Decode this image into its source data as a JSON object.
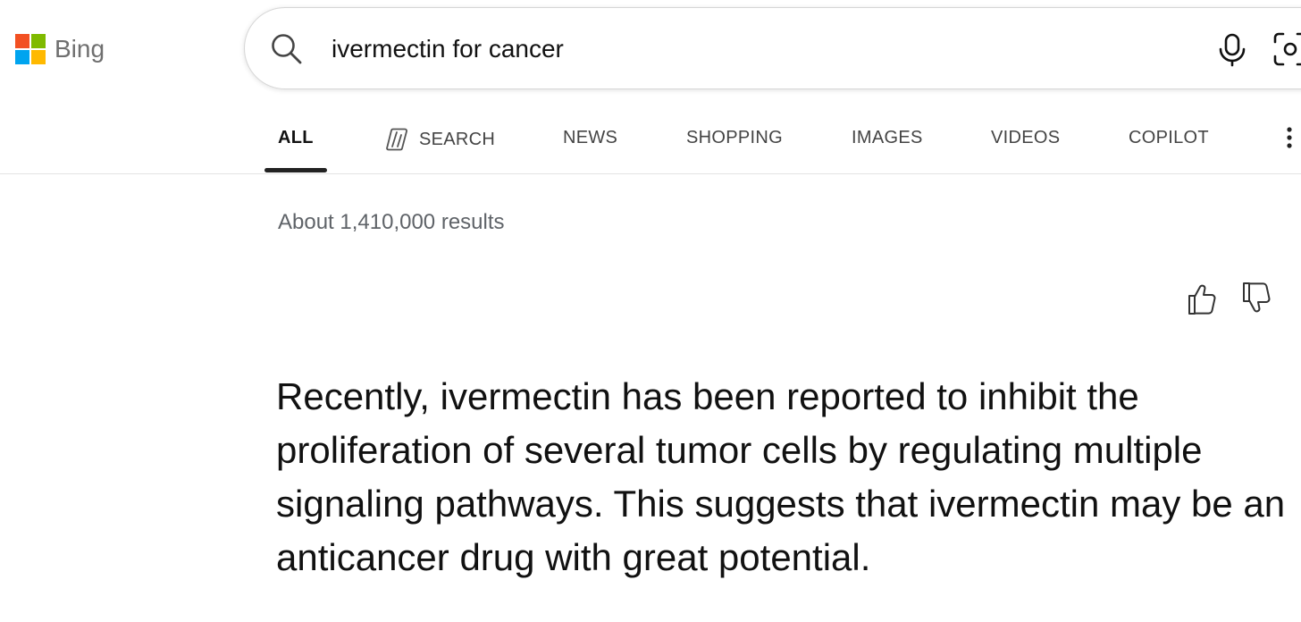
{
  "logo": {
    "text": "Bing",
    "colors": [
      "#f25022",
      "#7fba00",
      "#00a4ef",
      "#ffb900"
    ]
  },
  "search": {
    "query": "ivermectin for cancer",
    "icon": "search-icon",
    "mic_icon": "microphone-icon",
    "visual_icon": "visual-search-icon"
  },
  "tabs": [
    {
      "label": "ALL",
      "active": true
    },
    {
      "label": "SEARCH",
      "icon": "copilot-search-icon"
    },
    {
      "label": "NEWS"
    },
    {
      "label": "SHOPPING"
    },
    {
      "label": "IMAGES"
    },
    {
      "label": "VIDEOS"
    },
    {
      "label": "COPILOT"
    }
  ],
  "results": {
    "count_text": "About 1,410,000 results",
    "answer": "Recently, ivermectin has been reported to inhibit the proliferation of several tumor cells by regulating multiple signaling pathways. This suggests that ivermectin may be an anticancer drug with great potential."
  },
  "feedback": {
    "like_icon": "thumbs-up-icon",
    "dislike_icon": "thumbs-down-icon"
  }
}
